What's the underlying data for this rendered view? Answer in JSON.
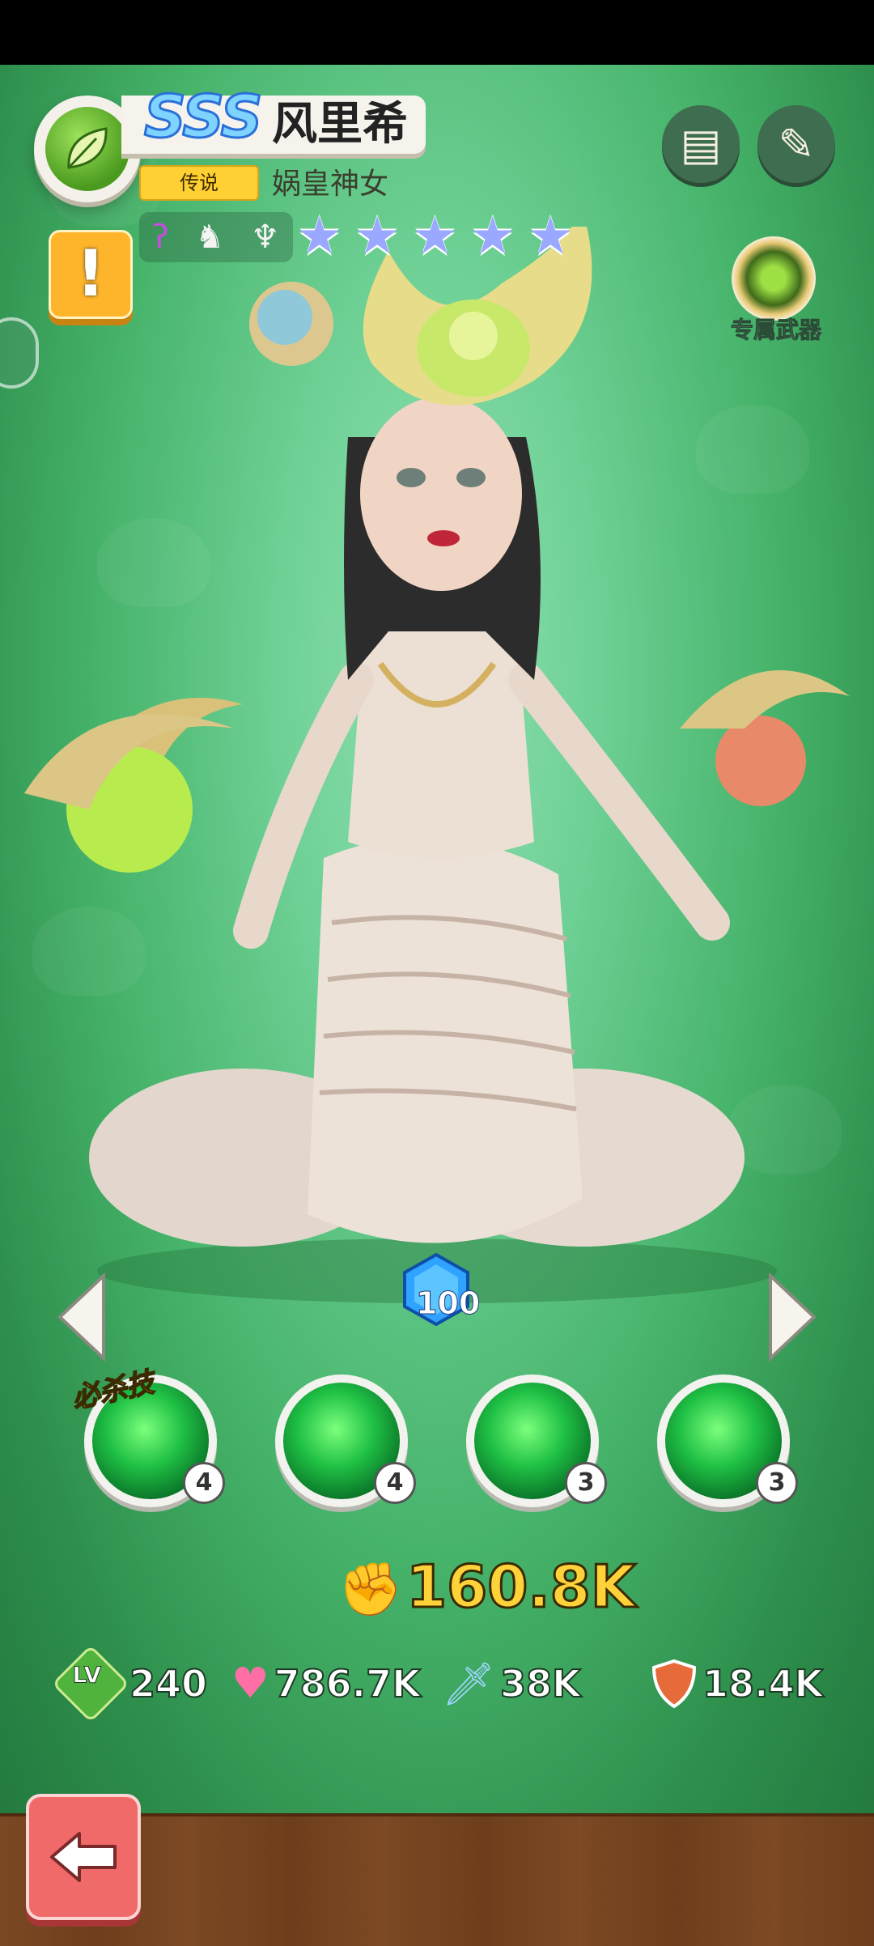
{
  "header": {
    "rank": "SSS",
    "hero_name": "风里希",
    "rarity": "传说",
    "hero_title": "娲皇神女",
    "stars": 5,
    "exclusive_weapon_label": "专属武器"
  },
  "skills": [
    {
      "level": "4",
      "ultimate": true
    },
    {
      "level": "4"
    },
    {
      "level": "3"
    },
    {
      "level": "3"
    }
  ],
  "ultimate_label": "必杀技",
  "gem_count": "100",
  "power": "160.8K",
  "stats": {
    "level_icon": "LV",
    "level": "240",
    "hp": "786.7K",
    "attack": "38K",
    "defense": "18.4K"
  },
  "colors": {
    "background": "#46b36a",
    "power": "#ffd23a",
    "rarity": "#ffd033",
    "back_button": "#f06a6a"
  }
}
